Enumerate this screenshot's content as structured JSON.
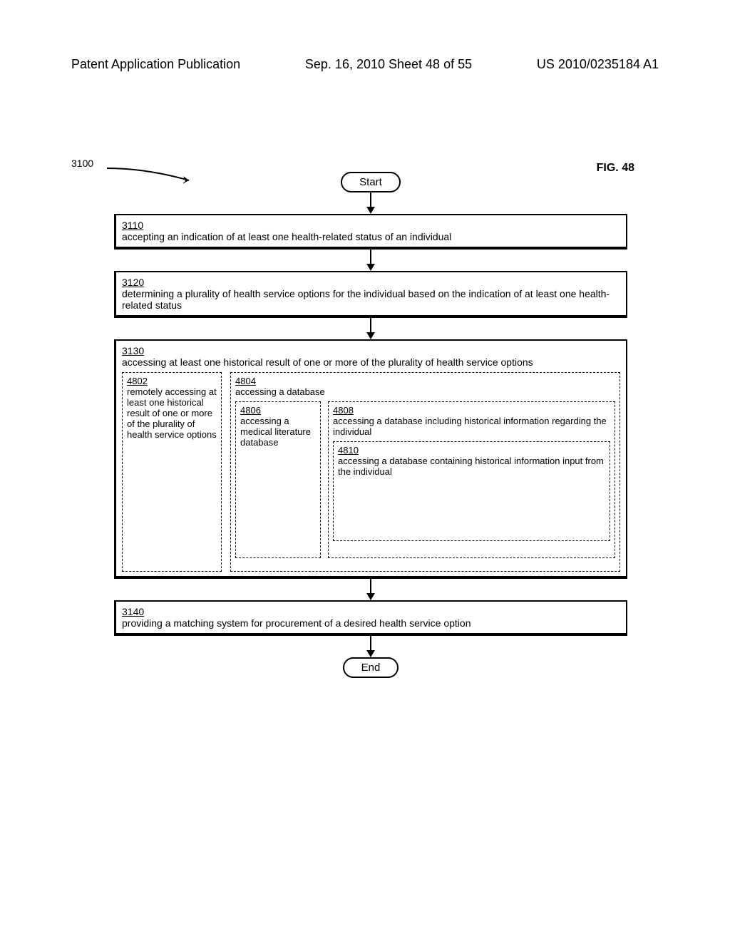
{
  "header": {
    "left": "Patent Application Publication",
    "center": "Sep. 16, 2010  Sheet 48 of 55",
    "right": "US 2010/0235184 A1"
  },
  "figure_label": "FIG. 48",
  "ref_num": "3100",
  "terminals": {
    "start": "Start",
    "end": "End"
  },
  "steps": {
    "s3110": {
      "num": "3110",
      "text": "accepting an indication of at least one health-related status of an individual"
    },
    "s3120": {
      "num": "3120",
      "text": "determining a plurality of health service options for the individual based on the indication of at least one health-related status"
    },
    "s3130": {
      "num": "3130",
      "text": "accessing at least one historical result of one or more of the plurality of health service options"
    },
    "s3140": {
      "num": "3140",
      "text": "providing a matching system for procurement of a desired health service option"
    }
  },
  "sub": {
    "b4802": {
      "num": "4802",
      "text": "remotely accessing at least one historical result of one or more of the plurality of health service options"
    },
    "b4804": {
      "num": "4804",
      "text": "accessing a database"
    },
    "b4806": {
      "num": "4806",
      "text": "accessing a medical literature database"
    },
    "b4808": {
      "num": "4808",
      "text": "accessing a database including historical information regarding the individual"
    },
    "b4810": {
      "num": "4810",
      "text": "accessing a database containing historical information input from the individual"
    }
  }
}
